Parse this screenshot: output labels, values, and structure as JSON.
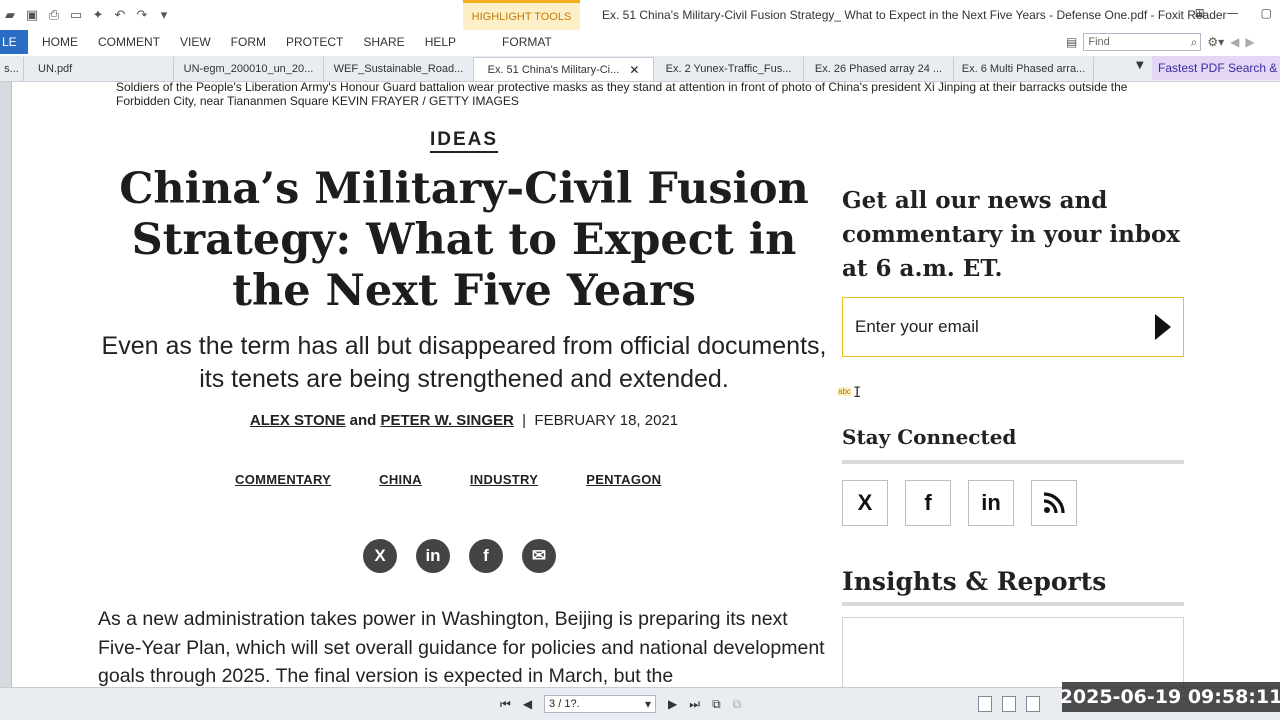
{
  "app": {
    "window_title": "Ex. 51 China's Military-Civil Fusion Strategy_ What to Expect in the Next Five Years - Defense One.pdf - Foxit Reader",
    "highlight_tools_label": "HIGHLIGHT TOOLS",
    "menu": [
      "LE",
      "HOME",
      "COMMENT",
      "VIEW",
      "FORM",
      "PROTECT",
      "SHARE",
      "HELP",
      "FORMAT"
    ],
    "find_placeholder": "Find",
    "tabs": [
      {
        "label": "s..."
      },
      {
        "label": "UN.pdf"
      },
      {
        "label": "UN-egm_200010_un_20..."
      },
      {
        "label": "WEF_Sustainable_Road..."
      },
      {
        "label": "Ex. 51 China's Military-Ci...",
        "active": true
      },
      {
        "label": "Ex. 2 Yunex-Traffic_Fus..."
      },
      {
        "label": "Ex. 26 Phased array 24 ..."
      },
      {
        "label": "Ex. 6 Multi Phased arra..."
      }
    ],
    "promo": "Fastest PDF Search &"
  },
  "article": {
    "caption": "Soldiers of the People's Liberation Army's Honour Guard battalion wear protective masks as they stand at attention in front of photo of China's president Xi Jinping at their barracks outside the Forbidden City, near Tiananmen Square KEVIN FRAYER / GETTY IMAGES",
    "section": "IDEAS",
    "headline": "China’s Military-Civil Fusion Strategy: What to Expect in the Next Five Years",
    "subhead": "Even as the term has all but disappeared from official documents, its tenets are being strengthened and extended.",
    "author1": "ALEX STONE",
    "and": "and",
    "author2": "PETER W. SINGER",
    "separator": "|",
    "date": "FEBRUARY 18, 2021",
    "tags": [
      "COMMENTARY",
      "CHINA",
      "INDUSTRY",
      "PENTAGON"
    ],
    "share": [
      "X",
      "in",
      "f",
      "✉"
    ],
    "body": "As a new administration takes power in Washington, Beijing is preparing its next Five-Year Plan, which will set overall guidance for policies and national development goals through 2025. The final version is expected in March, but the"
  },
  "sidebar": {
    "newsletter_title": "Get all our news and commentary in your inbox at 6 a.m. ET.",
    "email_placeholder": "Enter your email",
    "cursor_label": "abc",
    "stay_connected": "Stay Connected",
    "social": [
      "X",
      "f",
      "in",
      "rss"
    ],
    "insights_title": "Insights & Reports"
  },
  "status": {
    "page_field": "3 / 1?.",
    "timestamp": "2025-06-19 09:58:11"
  },
  "colors": {
    "file_tab": "#2b6cc4",
    "highlight_tab_bg": "#fdf0c8",
    "email_border": "#e8c21a",
    "promo_bg": "#e4d6f5"
  }
}
